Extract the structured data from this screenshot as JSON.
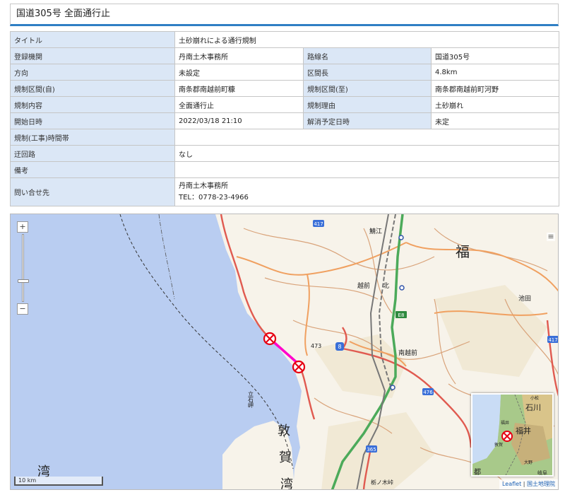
{
  "title": "国道305号 全面通行止",
  "info": {
    "title_label": "タイトル",
    "title_value": "土砂崩れによる通行規制",
    "agency_label": "登録機関",
    "agency_value": "丹南土木事務所",
    "route_label": "路線名",
    "route_value": "国道305号",
    "direction_label": "方向",
    "direction_value": "未設定",
    "section_length_label": "区間長",
    "section_length_value": "4.8km",
    "section_from_label": "規制区間(自)",
    "section_from_value": "南条郡南越前町糠",
    "section_to_label": "規制区間(至)",
    "section_to_value": "南条郡南越前町河野",
    "content_label": "規制内容",
    "content_value": "全面通行止",
    "reason_label": "規制理由",
    "reason_value": "土砂崩れ",
    "start_label": "開始日時",
    "start_value": "2022/03/18 21:10",
    "end_label": "解消予定日時",
    "end_value": "未定",
    "hours_label": "規制(工事)時間帯",
    "hours_value": "",
    "detour_label": "迂回路",
    "detour_value": "なし",
    "remarks_label": "備考",
    "remarks_value": "",
    "contact_label": "問い合せ先",
    "contact_name": "丹南土木事務所",
    "contact_tel": "TEL：0778-23-4966"
  },
  "map": {
    "zoom_in": "+",
    "zoom_out": "−",
    "scale": "10 km",
    "attribution_leaflet": "Leaflet",
    "attribution_sep": " | ",
    "attribution_gsi": "国土地理院",
    "labels": {
      "fukui_pref": "福",
      "sabae": "鯖江",
      "echizen": "越前",
      "kita": "北",
      "ikeda": "池田",
      "minamiechizen": "南越前",
      "peak": "473",
      "tateishi": "立石岬",
      "tsuruga_bay_1": "敦",
      "tsuruga_bay_2": "賀",
      "tsuruga_bay_3": "湾",
      "bay": "湾",
      "tochinoki": "栃ノ木峠",
      "e8": "E8",
      "r417a": "417",
      "r417b": "417",
      "r8": "8",
      "r476": "476",
      "r365": "365",
      "mini_ishikawa": "石川",
      "mini_komatsu": "小松",
      "mini_fukui": "福井",
      "mini_fukui_big": "福井",
      "mini_tsuruga": "敦賀",
      "mini_ono": "大野",
      "mini_kyoto": "都",
      "mini_gifu": "岐阜"
    }
  },
  "colors": {
    "accent": "#2f7fc4",
    "header_cell": "#dbe7f6",
    "sea": "#b9cdf1",
    "land": "#f7f3ea",
    "regulated_section": "#ff00cc",
    "closure_marker": "#e60012"
  }
}
